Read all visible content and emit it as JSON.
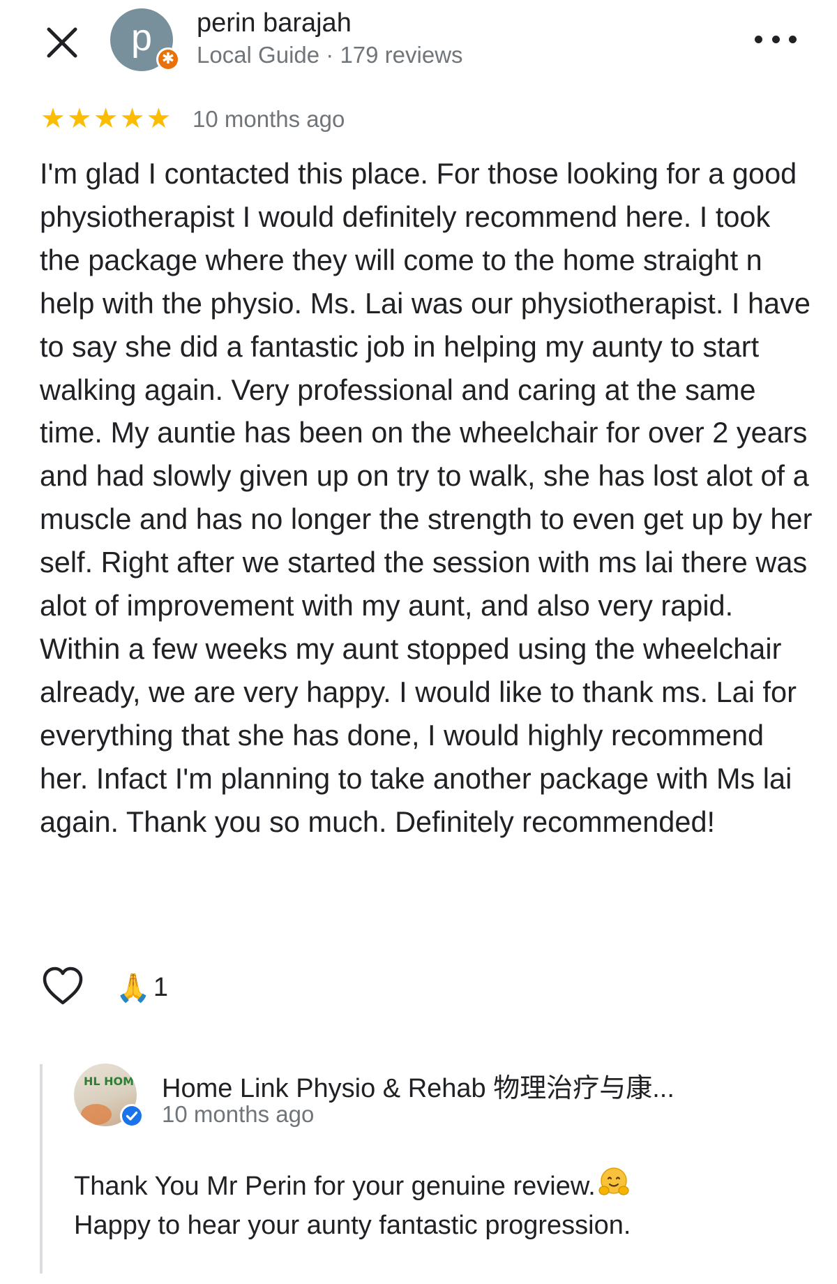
{
  "review": {
    "reviewer": {
      "name": "perin barajah",
      "avatar_letter": "p",
      "meta": "Local Guide · 179 reviews"
    },
    "rating": 5,
    "date": "10 months ago",
    "text": "I'm glad I contacted this place. For those looking for a good physiotherapist I would definitely recommend here. I took the package where they will come to the home straight n help with the physio. Ms. Lai was our physiotherapist. I have to say she did a fantastic job in helping my aunty to start walking again. Very professional and caring at the same time. My auntie has been on the wheelchair for over 2 years and had slowly given up on try to walk, she has lost alot of a muscle and has no longer the strength to even get up by her self. Right after we started the session with ms lai there was alot of improvement with my aunt, and also very rapid. Within a few weeks my aunt stopped using the wheelchair already, we are very happy. I would like to thank ms. Lai for everything that she has done, I would highly recommend her. Infact I'm planning to take another package with Ms lai again. Thank you so much. Definitely recommended!",
    "reactions": {
      "emoji": "🙏",
      "count": "1"
    }
  },
  "owner_reply": {
    "name": "Home Link Physio & Rehab 物理治疗与康...",
    "date": "10 months ago",
    "line1": "Thank You Mr Perin for your genuine review.",
    "line2": "Happy to hear your aunty fantastic progression."
  },
  "icons": {
    "close": "close-icon",
    "more": "more-horizontal-icon",
    "like": "heart-outline-icon",
    "local_guide": "local-guide-badge-icon",
    "verified": "verified-check-icon",
    "reaction": "praying-hands-icon",
    "reply_emoji": "hugging-face-icon"
  },
  "colors": {
    "star": "#fbbc04",
    "secondary_text": "#70757a",
    "local_guide_badge": "#e8710a",
    "verified_badge": "#1a73e8",
    "avatar_bg": "#78909c"
  }
}
